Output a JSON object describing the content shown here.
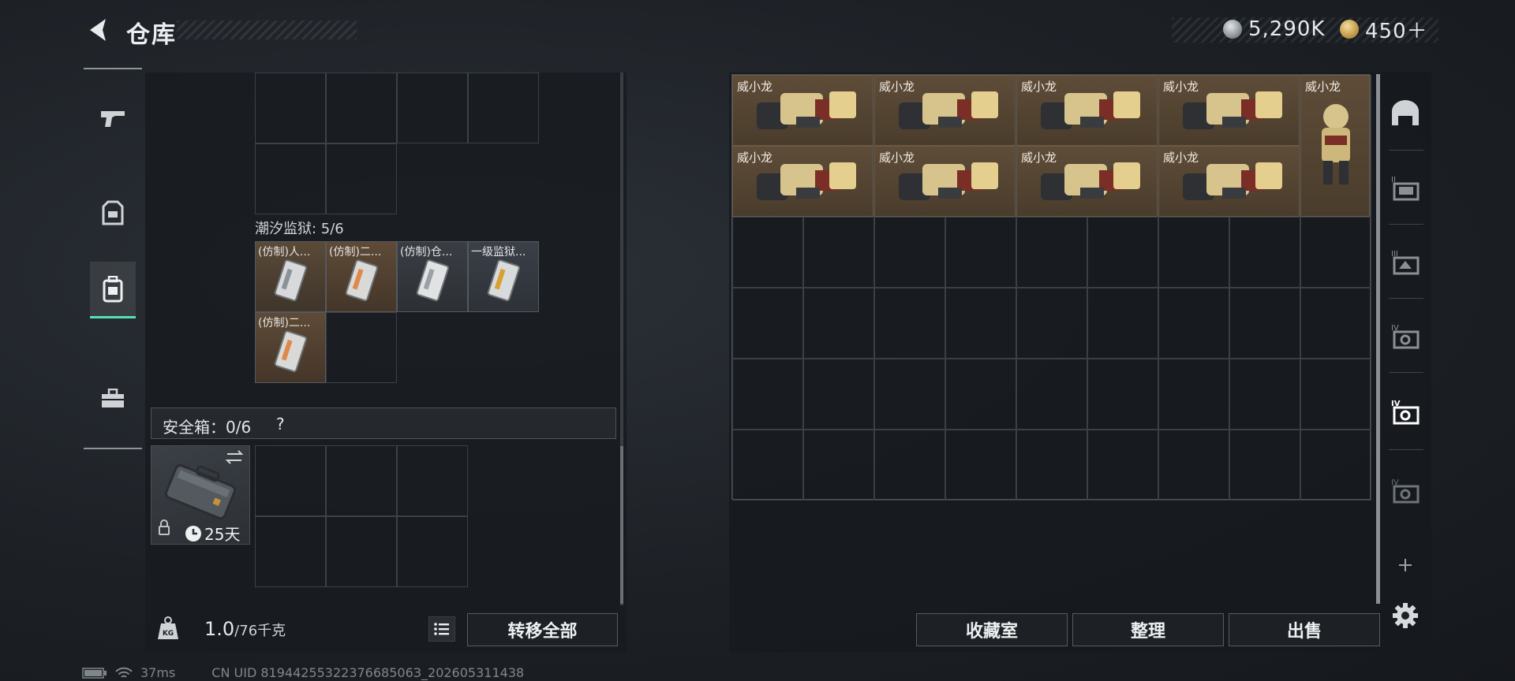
{
  "header": {
    "title": "仓库",
    "currency_silver": "5,290K",
    "currency_gold": "450＋"
  },
  "left_tabs": [
    {
      "name": "weapon-tab",
      "icon": "pistol-icon",
      "active": false
    },
    {
      "name": "armor-tab",
      "icon": "vest-icon",
      "active": false
    },
    {
      "name": "backpack-tab",
      "icon": "backpack-icon",
      "active": true
    },
    {
      "name": "case-tab",
      "icon": "toolbox-icon",
      "active": false
    }
  ],
  "backpack": {
    "section_title": "潮汐监狱: 5/6",
    "items": [
      {
        "label": "(仿制)人...",
        "color": "#b9bcc0"
      },
      {
        "label": "(仿制)二...",
        "color": "#e0884a"
      },
      {
        "label": "(仿制)仓...",
        "color": "#b9bcc0"
      },
      {
        "label": "一级监狱...",
        "color": "#d8a02c"
      },
      {
        "label": "(仿制)二...",
        "color": "#e0884a"
      }
    ]
  },
  "safe_box": {
    "label": "安全箱：0/6",
    "help": "?",
    "expiry": "25天"
  },
  "weight": {
    "current": "1.0",
    "capacity": "/76千克"
  },
  "buttons": {
    "transfer_all": "转移全部",
    "collection": "收藏室",
    "sort": "整理",
    "sell": "出售"
  },
  "storage": {
    "items": [
      {
        "label": "威小龙",
        "kind": "wide"
      },
      {
        "label": "威小龙",
        "kind": "wide"
      },
      {
        "label": "威小龙",
        "kind": "wide"
      },
      {
        "label": "威小龙",
        "kind": "wide"
      },
      {
        "label": "威小龙",
        "kind": "tall"
      },
      {
        "label": "威小龙",
        "kind": "wide"
      },
      {
        "label": "威小龙",
        "kind": "wide"
      },
      {
        "label": "威小龙",
        "kind": "wide"
      },
      {
        "label": "威小龙",
        "kind": "wide"
      }
    ]
  },
  "right_tabs": [
    {
      "name": "storage-main-tab",
      "icon": "warehouse-icon"
    },
    {
      "name": "storage-2-tab",
      "icon": "shelf-ii-icon"
    },
    {
      "name": "storage-3-tab",
      "icon": "shelf-iii-icon"
    },
    {
      "name": "storage-4-tab",
      "icon": "shelf-iv-icon"
    },
    {
      "name": "storage-5-tab",
      "icon": "shelf-iv-icon"
    },
    {
      "name": "storage-6-tab",
      "icon": "shelf-iv-icon"
    }
  ],
  "status": {
    "ping": "37ms",
    "uid": "CN UID 8194425532237668506З_202605311438"
  }
}
